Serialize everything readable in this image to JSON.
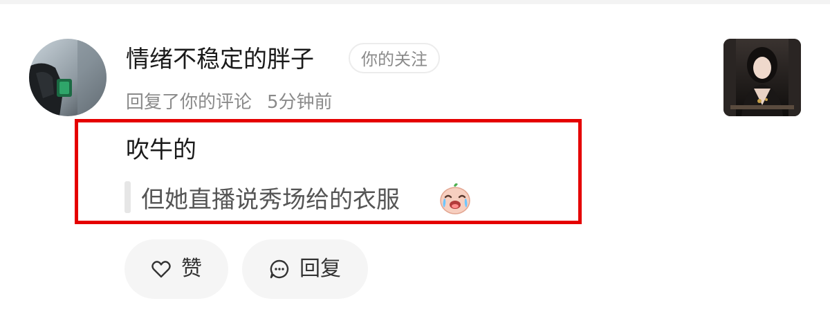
{
  "notification": {
    "username": "情绪不稳定的胖子",
    "follow_badge": "你的关注",
    "action_text": "回复了你的评论",
    "time_ago": "5分钟前",
    "reply_text": "吹牛的",
    "quoted_comment": "但她直播说秀场给的衣服",
    "emoji": "crying-laughing-face-icon"
  },
  "actions": {
    "like_label": "赞",
    "reply_label": "回复"
  },
  "colors": {
    "highlight_border": "#e50000",
    "secondary_text": "#8a8a8a",
    "button_bg": "#f5f5f5"
  }
}
